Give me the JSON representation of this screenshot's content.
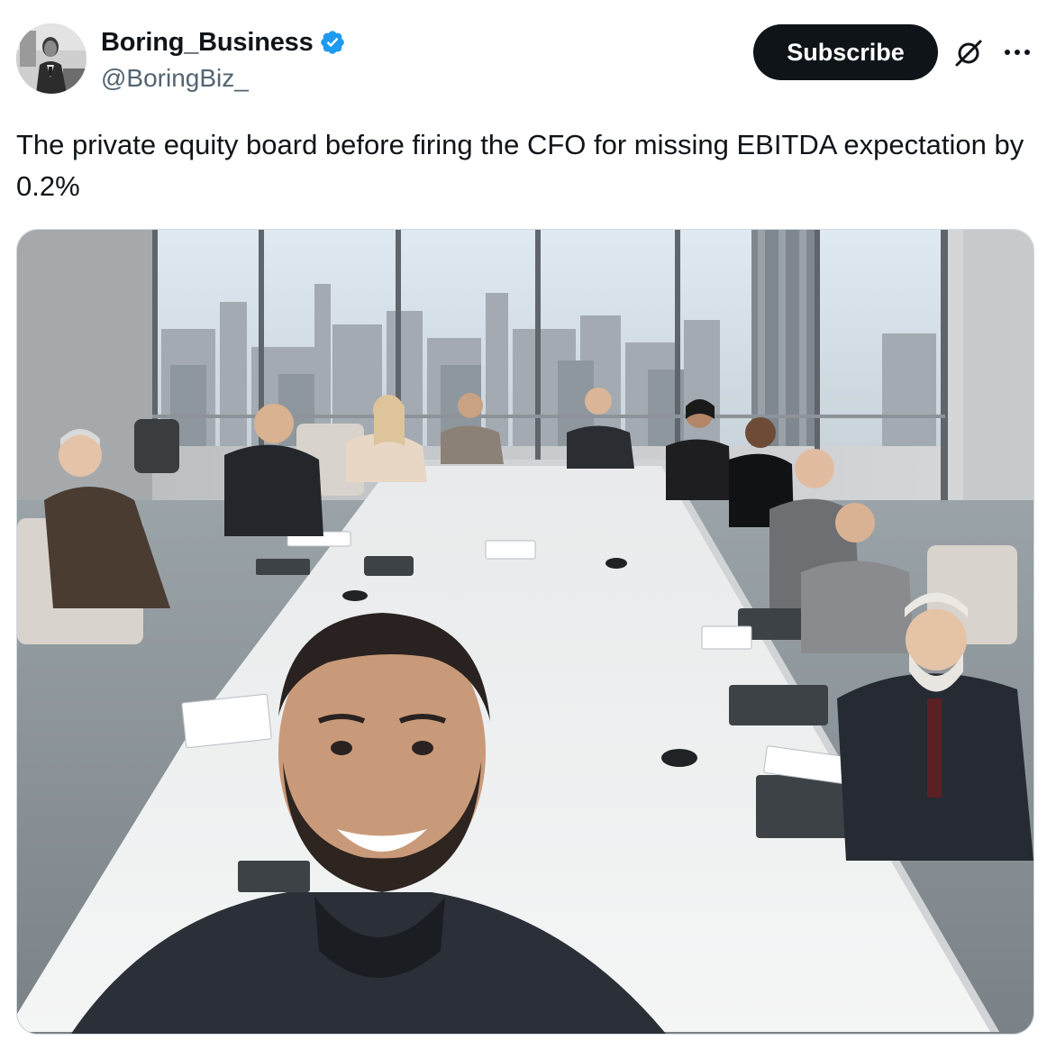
{
  "author": {
    "display_name": "Boring_Business",
    "handle": "@BoringBiz_",
    "verified": true,
    "verified_color": "#1d9bf0",
    "avatar_icon": "vintage-portrait-avatar"
  },
  "actions": {
    "subscribe_label": "Subscribe",
    "grok_icon": "grok-icon",
    "more_icon": "more-icon"
  },
  "tweet": {
    "text": "The private equity board before firing the CFO for missing EBITDA expectation by 0.2%"
  },
  "media": {
    "type": "photo",
    "alt": "Group selfie of board members around a long white conference table in a high-rise office overlooking a city skyline"
  },
  "colors": {
    "text_primary": "#0f1419",
    "text_secondary": "#536471",
    "button_bg": "#0f1419",
    "button_text": "#ffffff",
    "border": "#cfd9de"
  }
}
